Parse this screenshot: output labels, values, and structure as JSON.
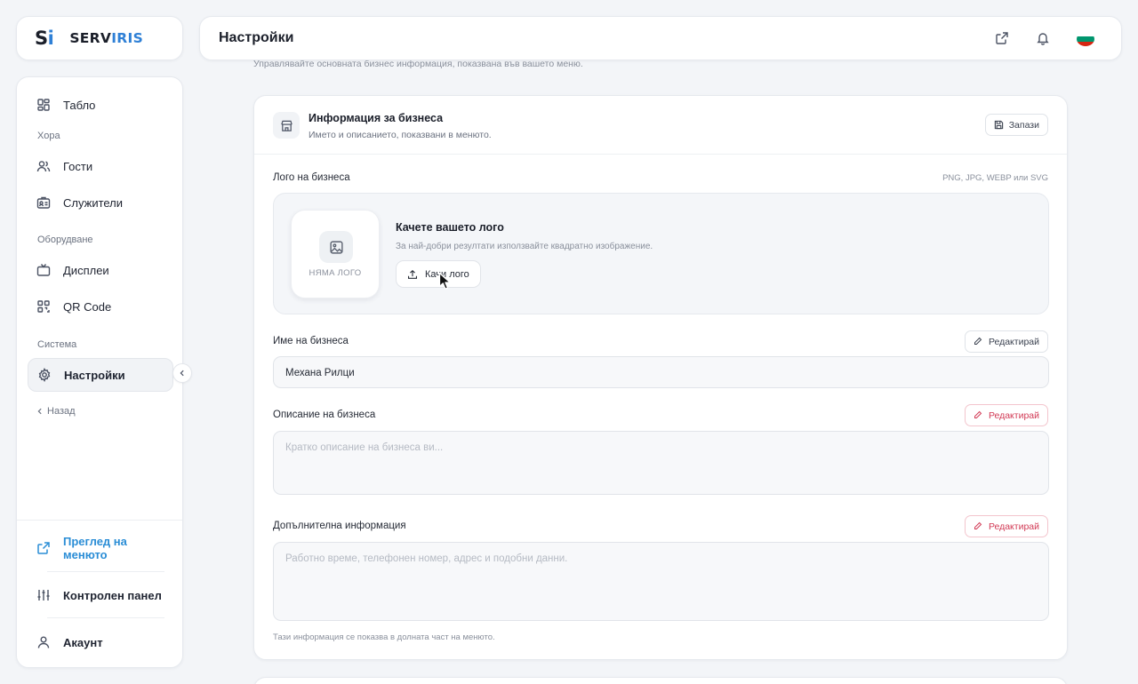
{
  "brand": {
    "mark_s": "S",
    "mark_i": "i",
    "word_a": "SERV",
    "word_b": "IRIS"
  },
  "sidebar": {
    "items": [
      {
        "label": "Табло",
        "icon": "dashboard-icon"
      },
      {
        "section": "Хора"
      },
      {
        "label": "Гости",
        "icon": "users-icon"
      },
      {
        "label": "Служители",
        "icon": "id-badge-icon"
      },
      {
        "section": "Оборудване"
      },
      {
        "label": "Дисплеи",
        "icon": "tv-icon"
      },
      {
        "label": "QR Code",
        "icon": "qr-code-icon"
      },
      {
        "section": "Система"
      },
      {
        "label": "Настройки",
        "icon": "gear-icon",
        "active": true
      }
    ],
    "back": "Назад",
    "bottom": {
      "menu_preview": "Преглед на менюто",
      "control_panel": "Контролен панел",
      "account": "Акаунт"
    }
  },
  "header": {
    "title": "Настройки"
  },
  "page": {
    "subtitle": "Управлявайте основната бизнес информация, показвана във вашето меню."
  },
  "business_info": {
    "title": "Информация за бизнеса",
    "subtitle": "Името и описанието, показвани в менюто.",
    "save_label": "Запази",
    "logo": {
      "label": "Лого на бизнеса",
      "formats": "PNG, JPG, WEBP или SVG",
      "placeholder": "НЯМА ЛОГО",
      "title": "Качете вашето лого",
      "hint": "За най-добри резултати използвайте квадратно изображение.",
      "button": "Качи лого"
    },
    "name": {
      "label": "Име на бизнеса",
      "value": "Механа Рилци",
      "edit": "Редактирай"
    },
    "description": {
      "label": "Описание на бизнеса",
      "placeholder": "Кратко описание на бизнеса ви...",
      "edit": "Редактирай"
    },
    "additional": {
      "label": "Допълнителна информация",
      "placeholder": "Работно време, телефонен номер, адрес и подобни данни.",
      "edit": "Редактирай",
      "hint": "Тази информация се показва в долната част на менюто."
    }
  },
  "colors": {
    "accent": "#2f80d6",
    "danger": "#d23a55",
    "flag": [
      "#ffffff",
      "#00966e",
      "#d62612"
    ]
  }
}
